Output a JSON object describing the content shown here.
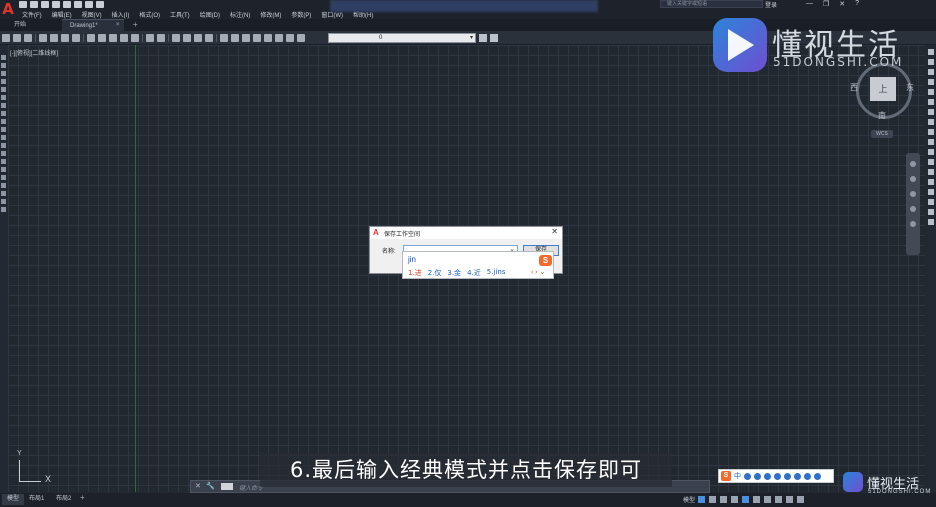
{
  "app": {
    "logo_letter": "A"
  },
  "menu": [
    "文件(F)",
    "编辑(E)",
    "视图(V)",
    "插入(I)",
    "格式(O)",
    "工具(T)",
    "绘图(D)",
    "标注(N)",
    "修改(M)",
    "参数(P)",
    "窗口(W)",
    "帮助(H)"
  ],
  "header": {
    "search_placeholder": "键入关键字或短语",
    "signin_label": "登录",
    "min": "—",
    "restore": "❐",
    "close": "✕",
    "help": "?"
  },
  "tabs": {
    "start": "开始",
    "drawing": "Drawing1*",
    "close": "×",
    "plus": "+"
  },
  "toolbar": {
    "layer_value": "0"
  },
  "viewport": {
    "label": "[-][俯视][二维线框]"
  },
  "viewcube": {
    "top": "上",
    "west": "西",
    "east": "东",
    "south": "南",
    "wcs": "WCS"
  },
  "watermark": {
    "name": "懂视生活",
    "url": "51DONGSHI.COM"
  },
  "dialog": {
    "title": "保存工作空间",
    "close": "✕",
    "name_label": "名称:",
    "name_value": "",
    "save_button": "保存"
  },
  "ime": {
    "input": "jin",
    "logo": "S",
    "candidates": [
      "1.进",
      "2.仅",
      "3.金",
      "4.近",
      "5.jins"
    ],
    "nav": "‹ › ⌄"
  },
  "ucs": {
    "y": "Y",
    "x": "X"
  },
  "cmdline": {
    "close": "✕",
    "wrench": "🔧",
    "placeholder": "键入命令"
  },
  "subtitle": "6.最后输入经典模式并点击保存即可",
  "statusbar": {
    "model_tab": "模型",
    "layout1": "布局1",
    "layout2": "布局2",
    "plus": "+",
    "model_label": "模型"
  },
  "ime_bar": {
    "logo": "S",
    "lang": "中"
  },
  "colors": {
    "accent": "#3c7fd1",
    "autocad_red": "#e2342f",
    "sogou_orange": "#f26a2c",
    "canvas": "#212830"
  }
}
